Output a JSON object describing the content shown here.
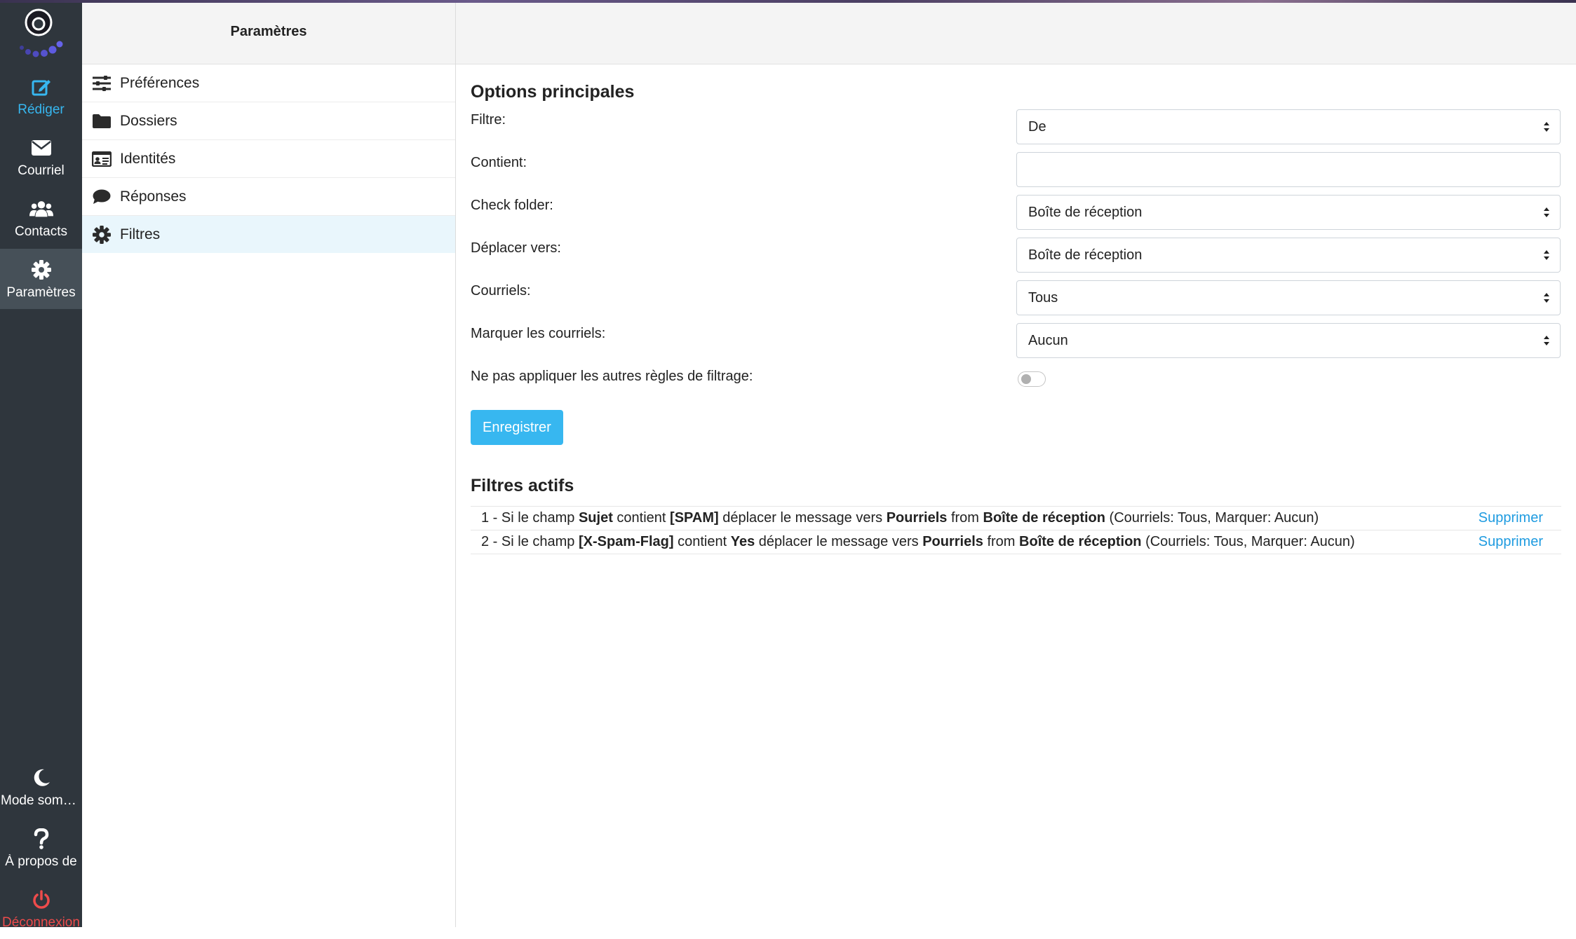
{
  "rail": {
    "items": [
      {
        "key": "compose",
        "label": "Rédiger",
        "icon": "edit-icon"
      },
      {
        "key": "mail",
        "label": "Courriel",
        "icon": "envelope-icon"
      },
      {
        "key": "contacts",
        "label": "Contacts",
        "icon": "users-icon"
      },
      {
        "key": "settings",
        "label": "Paramètres",
        "icon": "gear-icon"
      }
    ],
    "bottom": [
      {
        "key": "dark",
        "label": "Mode sombre",
        "icon": "moon-icon"
      },
      {
        "key": "about",
        "label": "À propos de",
        "icon": "question-icon"
      },
      {
        "key": "logout",
        "label": "Déconnexion",
        "icon": "power-icon"
      }
    ]
  },
  "settings": {
    "title": "Paramètres",
    "items": [
      {
        "label": "Préférences",
        "icon": "sliders-icon"
      },
      {
        "label": "Dossiers",
        "icon": "folder-icon"
      },
      {
        "label": "Identités",
        "icon": "id-card-icon"
      },
      {
        "label": "Réponses",
        "icon": "comment-icon"
      },
      {
        "label": "Filtres",
        "icon": "gear-icon"
      }
    ]
  },
  "main": {
    "options_title": "Options principales",
    "fields": {
      "filtre": {
        "label": "Filtre:",
        "value": "De"
      },
      "contient": {
        "label": "Contient:",
        "value": ""
      },
      "check_folder": {
        "label": "Check folder:",
        "value": "Boîte de réception"
      },
      "deplacer": {
        "label": "Déplacer vers:",
        "value": "Boîte de réception"
      },
      "courriels": {
        "label": "Courriels:",
        "value": "Tous"
      },
      "marquer": {
        "label": "Marquer les courriels:",
        "value": "Aucun"
      },
      "no_other_rules": {
        "label": "Ne pas appliquer les autres règles de filtrage:",
        "checked": false
      }
    },
    "save_label": "Enregistrer",
    "active_title": "Filtres actifs",
    "active_filters": [
      {
        "num": "1 - ",
        "t1": "Si le champ ",
        "field": "Sujet",
        "t2": " contient ",
        "value": "[SPAM]",
        "t3": " déplacer le message vers ",
        "dest": "Pourriels",
        "t4": " from ",
        "src": "Boîte de réception",
        "t5": " (Courriels: Tous, Marquer: Aucun)",
        "delete": "Supprimer"
      },
      {
        "num": "2 - ",
        "t1": "Si le champ ",
        "field": "[X-Spam-Flag]",
        "t2": " contient ",
        "value": "Yes",
        "t3": " déplacer le message vers ",
        "dest": "Pourriels",
        "t4": " from ",
        "src": "Boîte de réception",
        "t5": " (Courriels: Tous, Marquer: Aucun)",
        "delete": "Supprimer"
      }
    ]
  },
  "colors": {
    "rail_bg": "#2f363d",
    "accent": "#37b7f0",
    "danger": "#ee4b4b",
    "active_bg": "#e9f6fc"
  }
}
